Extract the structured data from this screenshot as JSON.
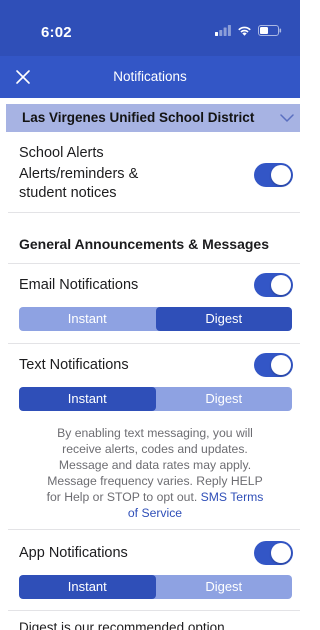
{
  "status_bar": {
    "time": "6:02",
    "icons": [
      "cellular-signal-icon",
      "wifi-icon",
      "battery-icon"
    ]
  },
  "nav": {
    "title": "Notifications",
    "close_icon": "close-icon"
  },
  "district": {
    "name": "Las Virgenes Unified School District",
    "chevron_icon": "chevron-down-icon"
  },
  "school_alerts": {
    "title": "School Alerts",
    "description_line1": "Alerts/reminders &",
    "description_line2": "student notices",
    "enabled": true
  },
  "general": {
    "heading": "General Announcements & Messages"
  },
  "email": {
    "label": "Email Notifications",
    "enabled": true,
    "options": [
      "Instant",
      "Digest"
    ],
    "selected": "Digest"
  },
  "text": {
    "label": "Text Notifications",
    "enabled": true,
    "options": [
      "Instant",
      "Digest"
    ],
    "selected": "Instant",
    "disclaimer_lines": [
      "By enabling text messaging, you will",
      "receive alerts, codes and updates.",
      "Message and data rates may apply.",
      "Message frequency varies. Reply HELP",
      "for Help or STOP to opt out."
    ],
    "sms_terms_part1": "SMS Terms",
    "sms_terms_part2": "of Service"
  },
  "app": {
    "label": "App Notifications",
    "enabled": true,
    "options": [
      "Instant",
      "Digest"
    ],
    "selected": "Instant"
  },
  "footer_partial": "Digest is our recommended option",
  "colors": {
    "brand_blue": "#3356c6",
    "status_blue": "#2f4fb8",
    "district_bar": "#a7b3e3",
    "segment_inactive": "#8ea2e2"
  }
}
